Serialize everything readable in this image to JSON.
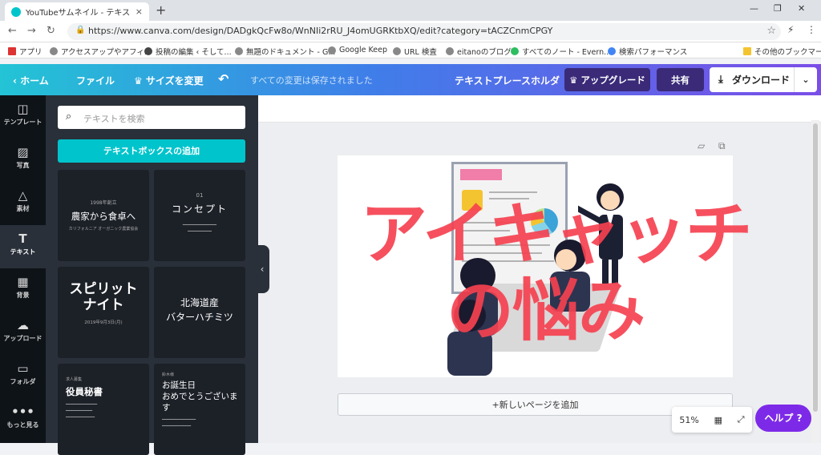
{
  "browser": {
    "tab_title": "YouTubeサムネイル - テキストプレース",
    "tab_close": "×",
    "new_tab": "+",
    "url": "https://www.canva.com/design/DADgkQcFw8o/WnNIi2rRU_J4omUGRKtbXQ/edit?category=tACZCnmCPGY",
    "bookmarks": [
      "アプリ",
      "アクセスアップやアフィ...",
      "投稿の編集 ‹ そして...",
      "無題のドキュメント - G...",
      "Google Keep",
      "URL 検査",
      "eitanoのブログ",
      "すべてのノート - Evern...",
      "検索パフォーマンス"
    ],
    "other_bookmarks": "その他のブックマーク"
  },
  "topbar": {
    "home": "‹ ホーム",
    "file": "ファイル",
    "resize": "♛ サイズを変更",
    "undo": "↶",
    "saved_status": "すべての変更は保存されました",
    "doc_title": "テキストプレースホルダ",
    "upgrade": "♛ アップグレード",
    "share": "共有",
    "download": "ダウンロード"
  },
  "rail": [
    {
      "label": "テンプレート",
      "icon": "template-icon"
    },
    {
      "label": "写真",
      "icon": "photo-icon"
    },
    {
      "label": "素材",
      "icon": "elements-icon"
    },
    {
      "label": "テキスト",
      "icon": "text-icon"
    },
    {
      "label": "背景",
      "icon": "background-icon"
    },
    {
      "label": "アップロード",
      "icon": "upload-icon"
    },
    {
      "label": "フォルダ",
      "icon": "folder-icon"
    },
    {
      "label": "もっと見る",
      "icon": "more-icon"
    }
  ],
  "panel": {
    "search_placeholder": "テキストを検索",
    "add_textbox": "テキストボックスの追加",
    "templates": [
      {
        "small": "1998年創立",
        "main": "農家から食卓へ",
        "sub": "カリフォルニア オーガニック農業協会"
      },
      {
        "small": "01",
        "main": "コンセプト",
        "sub": ""
      },
      {
        "main": "スピリット\nナイト",
        "sub": "2019年9月3日(月)"
      },
      {
        "main": "北海道産\nバターハチミツ",
        "sub": ""
      },
      {
        "small": "求人募集",
        "main": "役員秘書",
        "sub": ""
      },
      {
        "small": "鈴木様",
        "main": "お誕生日\nおめでとうございます",
        "sub": ""
      }
    ]
  },
  "canvas": {
    "headline_line1": "アイキャッチ",
    "headline_line2": "の悩み",
    "add_page": "+新しいページを追加"
  },
  "footer": {
    "zoom": "51%",
    "help": "ヘルプ ?"
  },
  "colors": {
    "accent_teal": "#00c4cc",
    "accent_purple": "#7d2ae8",
    "headline_red": "#f54150"
  }
}
